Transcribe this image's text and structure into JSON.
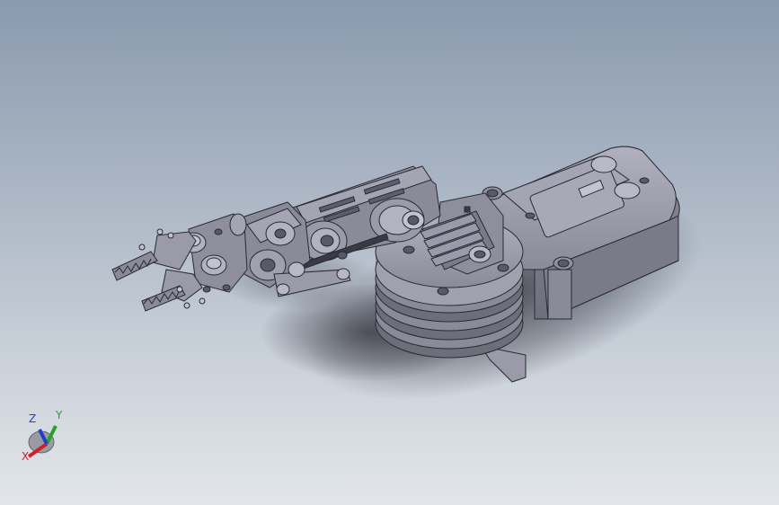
{
  "viewport": {
    "model_name": "robot-arm-assembly",
    "background_top": "#8a9aae",
    "background_bottom": "#e2e6ea",
    "part_color": "#9a9aa8",
    "part_shadow": "#6f6f7c",
    "edge_color": "#2a2a33"
  },
  "triad": {
    "x_label": "X",
    "y_label": "Y",
    "z_label": "Z",
    "x_color": "#d0202a",
    "y_color": "#2aa02a",
    "z_color": "#2040c8"
  }
}
